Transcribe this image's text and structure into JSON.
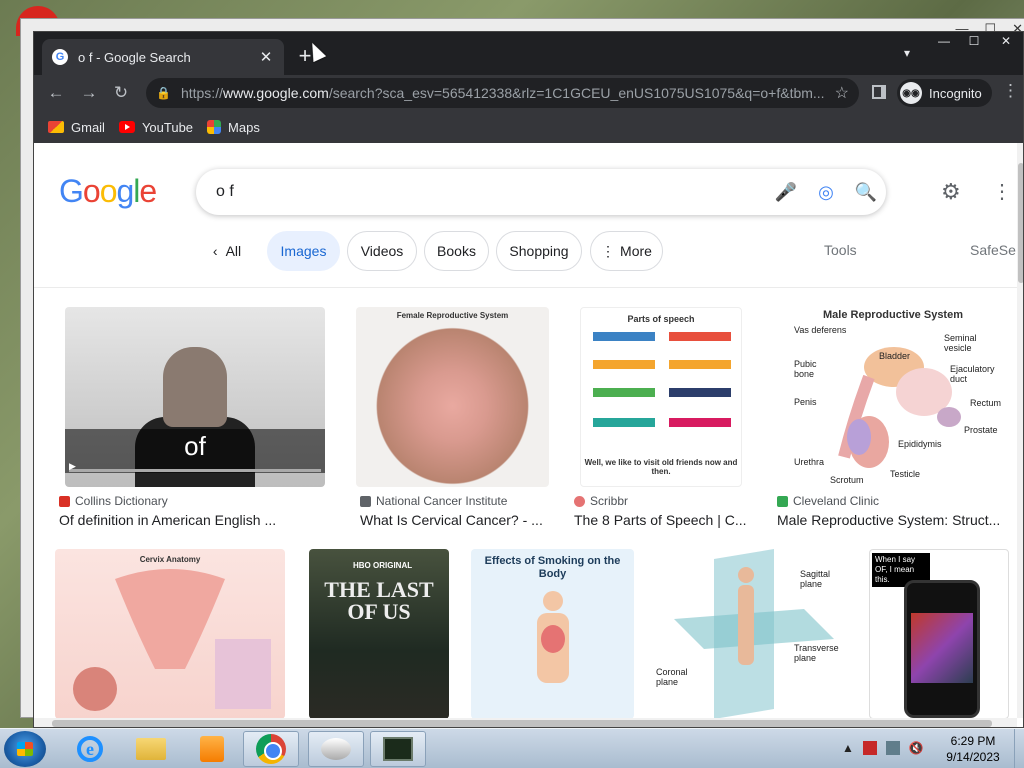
{
  "browser": {
    "tab_title": "o f - Google Search",
    "tab_favicon": "G",
    "tab_close": "✕",
    "new_tab": "+",
    "tab_dropdown": "⌄",
    "url_domain": "www.google.com",
    "url_prefix": "https://",
    "url_path": "/search?sca_esv=565412338&rlz=1C1GCEU_enUS1075US1075&q=o+f&tbm...",
    "incognito_label": "Incognito",
    "bookmarks": [
      {
        "label": "Gmail",
        "icon": "gmail-icon"
      },
      {
        "label": "YouTube",
        "icon": "youtube-icon"
      },
      {
        "label": "Maps",
        "icon": "maps-icon"
      }
    ]
  },
  "google": {
    "logo_letters": [
      "G",
      "o",
      "o",
      "g",
      "l",
      "e"
    ],
    "logo_colors": [
      "#4285f4",
      "#ea4335",
      "#fbbc05",
      "#4285f4",
      "#34a853",
      "#ea4335"
    ],
    "query": "o f",
    "chips": {
      "all": "All",
      "images": "Images",
      "videos": "Videos",
      "books": "Books",
      "shopping": "Shopping",
      "more": "More"
    },
    "tools": "Tools",
    "safesearch": "SafeSe"
  },
  "results": [
    {
      "source": "Collins Dictionary",
      "title": "Of definition in American English ...",
      "source_color": "#d93025",
      "image_word": "of"
    },
    {
      "source": "National Cancer Institute",
      "title": "What Is Cervical Cancer? - ...",
      "source_color": "#5f6368",
      "image_header": "Female Reproductive System"
    },
    {
      "source": "Scribbr",
      "title": "The 8 Parts of Speech | C...",
      "source_color": "#e57373",
      "image_header": "Parts of speech",
      "image_footer": "Well, we like to visit old friends now and then."
    },
    {
      "source": "Cleveland Clinic",
      "title": "Male Reproductive System: Struct...",
      "source_color": "#34a853",
      "image_header": "Male Reproductive System",
      "image_labels": [
        "Vas deferens",
        "Seminal vesicle",
        "Bladder",
        "Pubic bone",
        "Ejaculatory duct",
        "Penis",
        "Rectum",
        "Prostate",
        "Epididymis",
        "Urethra",
        "Testicle",
        "Scrotum"
      ]
    }
  ],
  "row2": [
    {
      "image_header": "Cervix Anatomy"
    },
    {
      "image_header": "HBO ORIGINAL",
      "image_title": "THE LAST OF US"
    },
    {
      "image_header": "Effects of Smoking on the Body"
    },
    {
      "image_labels": [
        "Sagittal plane",
        "Transverse plane",
        "Coronal plane"
      ]
    },
    {
      "image_header": "When I say OF, I mean this."
    }
  ],
  "taskbar": {
    "time": "6:29 PM",
    "date": "9/14/2023"
  },
  "background_window": {
    "controls": [
      "—",
      "☐",
      "✕"
    ]
  }
}
